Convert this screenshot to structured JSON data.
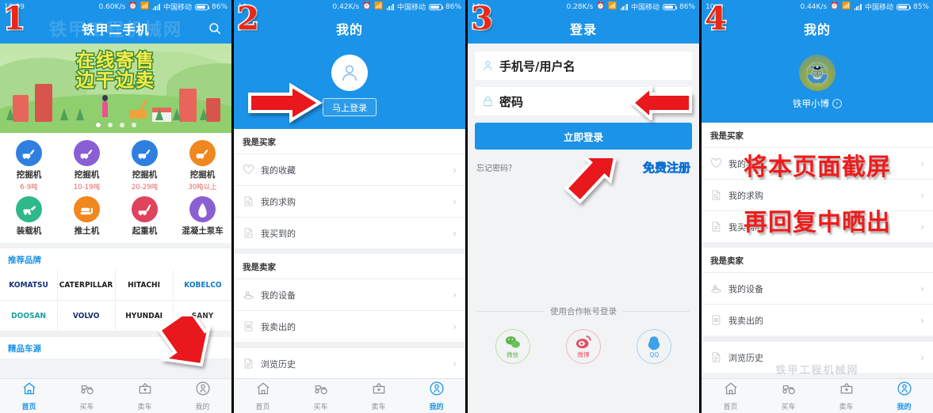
{
  "meta": {
    "blue": "#1b93e8",
    "red": "#e8281b",
    "grey_bg": "#f2f3f5"
  },
  "panels": [
    {
      "badge": "1",
      "status": {
        "time": "10:09",
        "speed": "0.60K/s",
        "carrier": "中国移动",
        "battery": "86%"
      },
      "title": "铁甲二手机",
      "watermark": "铁甲工程机械网",
      "banner": {
        "line1": "在线寄售",
        "line2": "边干边卖",
        "dots": 4,
        "active_dot": 0
      },
      "categories": [
        {
          "name": "挖掘机",
          "sub": "6-9吨",
          "color": "#2f7fe0",
          "icon": "excavator-icon"
        },
        {
          "name": "挖掘机",
          "sub": "10-19吨",
          "color": "#8a5fd4",
          "icon": "excavator-icon"
        },
        {
          "name": "挖掘机",
          "sub": "20-29吨",
          "color": "#2f7fe0",
          "icon": "excavator-icon"
        },
        {
          "name": "挖掘机",
          "sub": "30吨以上",
          "color": "#f0871f",
          "icon": "excavator-icon"
        },
        {
          "name": "装载机",
          "sub": "",
          "color": "#2fb88a",
          "icon": "loader-icon"
        },
        {
          "name": "推土机",
          "sub": "",
          "color": "#f0871f",
          "icon": "bulldozer-icon"
        },
        {
          "name": "起重机",
          "sub": "",
          "color": "#e0435c",
          "icon": "crane-icon"
        },
        {
          "name": "混凝土泵车",
          "sub": "",
          "color": "#8a5fd4",
          "icon": "pumptruck-icon"
        }
      ],
      "brand_section_title": "推荐品牌",
      "brands": [
        {
          "label": "KOMATSU",
          "color": "#16317a"
        },
        {
          "label": "CATERPILLAR",
          "color": "#1c1c1c"
        },
        {
          "label": "HITACHI",
          "color": "#1c1c1c"
        },
        {
          "label": "KOBELCO",
          "color": "#1478c4"
        },
        {
          "label": "DOOSAN",
          "color": "#1a9ea0"
        },
        {
          "label": "VOLVO",
          "color": "#17306e"
        },
        {
          "label": "HYUNDAI",
          "color": "#1c1c1c"
        },
        {
          "label": "SANY",
          "color": "#3a3a3a"
        }
      ],
      "featured_title": "精品车源",
      "tabs": [
        {
          "label": "首页",
          "icon": "home-icon",
          "active": true
        },
        {
          "label": "买车",
          "icon": "tractor-icon",
          "active": false
        },
        {
          "label": "卖车",
          "icon": "sell-icon",
          "active": false
        },
        {
          "label": "我的",
          "icon": "person-icon",
          "active": false
        }
      ]
    },
    {
      "badge": "2",
      "status": {
        "time": "10",
        "speed": "0.42K/s",
        "carrier": "中国移动",
        "battery": "86%"
      },
      "title": "我的",
      "login_button": "马上登录",
      "groups": [
        {
          "header": "我是买家",
          "rows": [
            {
              "label": "我的收藏",
              "icon": "heart-icon"
            },
            {
              "label": "我的求购",
              "icon": "request-icon"
            },
            {
              "label": "我买到的",
              "icon": "doc-icon"
            }
          ]
        },
        {
          "header": "我是卖家",
          "rows": [
            {
              "label": "我的设备",
              "icon": "machine-icon"
            },
            {
              "label": "我卖出的",
              "icon": "checkdoc-icon"
            }
          ]
        }
      ],
      "partial_row": "浏览历史",
      "tabs": [
        {
          "label": "首页",
          "icon": "home-icon",
          "active": false
        },
        {
          "label": "买车",
          "icon": "tractor-icon",
          "active": false
        },
        {
          "label": "卖车",
          "icon": "sell-icon",
          "active": false
        },
        {
          "label": "我的",
          "icon": "person-icon",
          "active": true
        }
      ]
    },
    {
      "badge": "3",
      "status": {
        "time": "10",
        "speed": "0.28K/s",
        "carrier": "中国移动",
        "battery": "86%"
      },
      "title": "登录",
      "fields": [
        {
          "placeholder": "手机号/用户名",
          "icon": "user-icon",
          "value": ""
        },
        {
          "placeholder": "密码",
          "icon": "lock-icon",
          "value": "",
          "trailing_icon": "eye-icon"
        }
      ],
      "submit_label": "立即登录",
      "forgot_label": "忘记密码？",
      "register_label": "免费注册",
      "partner_title": "使用合作帐号登录",
      "partners": [
        {
          "label": "微信",
          "icon": "wechat-icon",
          "color": "#5fb44a"
        },
        {
          "label": "微博",
          "icon": "weibo-icon",
          "color": "#e05263"
        },
        {
          "label": "QQ",
          "icon": "qq-icon",
          "color": "#3ba1e8"
        }
      ]
    },
    {
      "badge": "4",
      "status": {
        "time": "10",
        "speed": "0.44K/s",
        "carrier": "中国移动",
        "battery": "85%"
      },
      "title": "我的",
      "username": "铁甲小博",
      "overlay_lines": [
        "将本页面截屏",
        "再回复中晒出"
      ],
      "groups": [
        {
          "header": "我是买家",
          "rows": [
            {
              "label": "我的收藏",
              "icon": "heart-icon"
            },
            {
              "label": "我的求购",
              "icon": "request-icon"
            },
            {
              "label": "我买到的",
              "icon": "doc-icon"
            }
          ]
        },
        {
          "header": "我是卖家",
          "rows": [
            {
              "label": "我的设备",
              "icon": "machine-icon"
            },
            {
              "label": "我卖出的",
              "icon": "checkdoc-icon"
            }
          ]
        }
      ],
      "partial_row": "浏览历史",
      "watermark": "铁甲工程机械网",
      "tabs": [
        {
          "label": "首页",
          "icon": "home-icon",
          "active": false
        },
        {
          "label": "买车",
          "icon": "tractor-icon",
          "active": false
        },
        {
          "label": "卖车",
          "icon": "sell-icon",
          "active": false
        },
        {
          "label": "我的",
          "icon": "person-icon",
          "active": true
        }
      ]
    }
  ]
}
